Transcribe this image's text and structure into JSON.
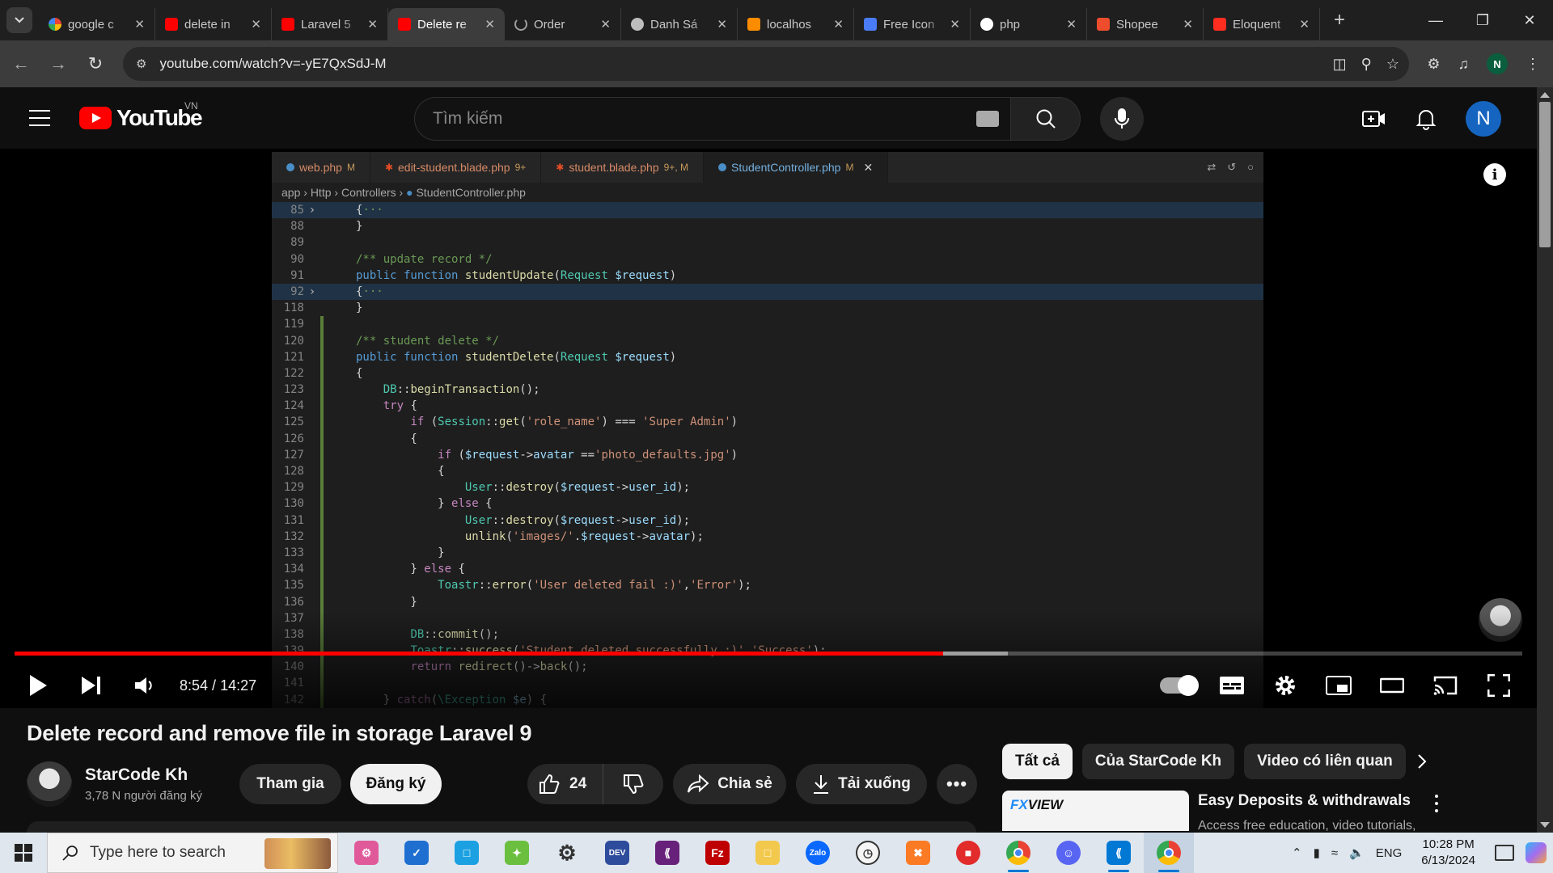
{
  "browser": {
    "tabs": [
      {
        "title": "google c",
        "favicon": "google-icon",
        "color": "#ffffff",
        "active": false
      },
      {
        "title": "delete in",
        "favicon": "youtube-icon",
        "color": "#ff0000",
        "active": false
      },
      {
        "title": "Laravel 5",
        "favicon": "youtube-icon",
        "color": "#ff0000",
        "active": false
      },
      {
        "title": "Delete re",
        "favicon": "youtube-icon",
        "color": "#ff0000",
        "active": true
      },
      {
        "title": "Order",
        "favicon": "loading-icon",
        "color": "#9e9e9e",
        "active": false
      },
      {
        "title": "Danh Sá",
        "favicon": "globe-icon",
        "color": "#bdbdbd",
        "active": false
      },
      {
        "title": "localhos",
        "favicon": "xampp-icon",
        "color": "#fb8c00",
        "active": false
      },
      {
        "title": "Free Icon",
        "favicon": "flaticon-icon",
        "color": "#4a7cf7",
        "active": false
      },
      {
        "title": "php",
        "favicon": "openai-icon",
        "color": "#ffffff",
        "active": false
      },
      {
        "title": "Shopee",
        "favicon": "shopee-icon",
        "color": "#ee4d2d",
        "active": false
      },
      {
        "title": "Eloquent",
        "favicon": "laravel-icon",
        "color": "#ff2d20",
        "active": false
      }
    ],
    "url": "youtube.com/watch?v=-yE7QxSdJ-M",
    "profile_initial": "N"
  },
  "youtube": {
    "logo_text": "YouTube",
    "region": "VN",
    "search_placeholder": "Tìm kiếm",
    "avatar_initial": "N"
  },
  "editor": {
    "tabs": [
      {
        "name": "web.php",
        "status": "M",
        "active": false
      },
      {
        "name": "edit-student.blade.php",
        "status": "9+",
        "active": false
      },
      {
        "name": "student.blade.php",
        "status": "9+, M",
        "active": false
      },
      {
        "name": "StudentController.php",
        "status": "M",
        "active": true
      }
    ],
    "breadcrumb": [
      "app",
      "Http",
      "Controllers",
      "StudentController.php"
    ]
  },
  "player": {
    "time_current": "8:54",
    "time_total": "14:27",
    "progress_fraction": 0.616,
    "buffered_fraction": 0.659,
    "colors": {
      "progress": "#ff0000"
    }
  },
  "video": {
    "title": "Delete record and remove file in storage Laravel 9",
    "channel": "StarCode Kh",
    "subscribers": "3,78 N người đăng ký",
    "join_label": "Tham gia",
    "subscribe_label": "Đăng ký",
    "likes": "24",
    "share_label": "Chia sẻ",
    "download_label": "Tải xuống"
  },
  "related": {
    "chips": [
      "Tất cả",
      "Của StarCode Kh",
      "Video có liên quan"
    ],
    "first": {
      "thumb_brand": "FXVIEW",
      "title": "Easy Deposits & withdrawals",
      "desc": "Access free education, video tutorials,"
    }
  },
  "taskbar": {
    "search_placeholder": "Type here to search",
    "language": "ENG",
    "time": "10:28 PM",
    "date": "6/13/2024"
  }
}
